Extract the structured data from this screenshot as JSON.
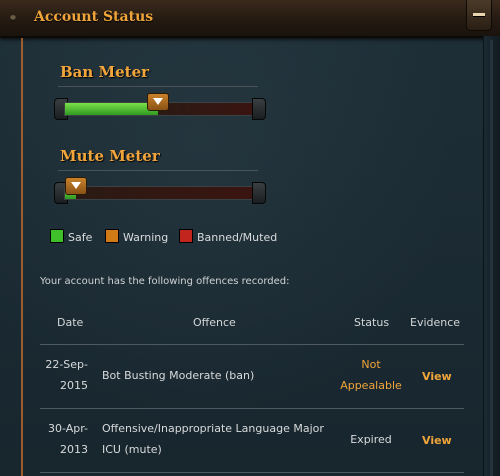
{
  "header": {
    "title": "Account Status"
  },
  "ban_meter": {
    "title": "Ban Meter",
    "level": 0.49,
    "state": "Safe"
  },
  "mute_meter": {
    "title": "Mute Meter",
    "level": 0.06,
    "state": "Safe"
  },
  "legend": [
    {
      "label": "Safe",
      "color": "#3fbf2a"
    },
    {
      "label": "Warning",
      "color": "#d07a18"
    },
    {
      "label": "Banned/Muted",
      "color": "#c1251e"
    }
  ],
  "offences_intro": "Your account has the following offences recorded:",
  "table": {
    "columns": {
      "date": "Date",
      "offence": "Offence",
      "status": "Status",
      "evidence": "Evidence"
    },
    "rows": [
      {
        "date_line1": "22-Sep-",
        "date_line2": "2015",
        "offence_line1": "Bot Busting Moderate (ban)",
        "offence_line2": "",
        "status_line1": "Not",
        "status_line2": "Appealable",
        "evidence": "View"
      },
      {
        "date_line1": "30-Apr-",
        "date_line2": "2013",
        "offence_line1": "Offensive/Inappropriate Language Major",
        "offence_line2": "ICU (mute)",
        "status_line1": "Expired",
        "status_line2": "",
        "evidence": "View"
      }
    ]
  }
}
